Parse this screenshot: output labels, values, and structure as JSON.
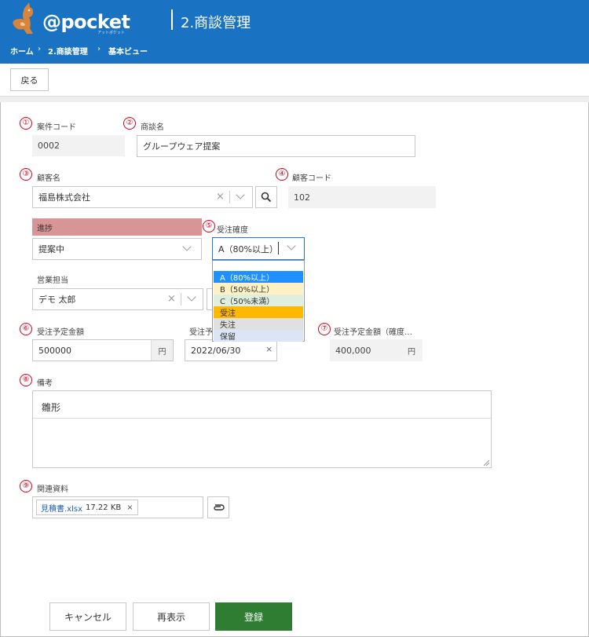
{
  "header": {
    "logo_text": "@pocket",
    "logo_sub": "アットポケット",
    "title": "2.商談管理",
    "breadcrumb": [
      "ホーム",
      "2.商談管理",
      "基本ビュー"
    ],
    "breadcrumb_sep": "›",
    "bg_color": "#1a73c2"
  },
  "toolbar": {
    "back_label": "戻る"
  },
  "markers": [
    "①",
    "②",
    "③",
    "④",
    "⑤",
    "⑥",
    "⑦",
    "⑧",
    "⑨"
  ],
  "form": {
    "case_code": {
      "label": "案件コード",
      "value": "0002"
    },
    "deal_name": {
      "label": "商談名",
      "value": "グループウェア提案"
    },
    "customer_name": {
      "label": "顧客名",
      "value": "福島株式会社",
      "clear_icon": "close-icon",
      "search_icon": "search-icon"
    },
    "customer_code": {
      "label": "顧客コード",
      "value": "102"
    },
    "progress": {
      "label": "進捗",
      "value": "提案中",
      "label_bg": "#d99595"
    },
    "probability": {
      "label": "受注確度",
      "value": "A（80%以上）",
      "options": [
        {
          "label": "",
          "bg": "#ffffff"
        },
        {
          "label": "A（80%以上）",
          "bg": "#1e90ff"
        },
        {
          "label": "B（50%以上）",
          "bg": "#fff1c4"
        },
        {
          "label": "C（50%未満）",
          "bg": "#dfeedd"
        },
        {
          "label": "受注",
          "bg": "#ffb800"
        },
        {
          "label": "失注",
          "bg": "#e0e0e0"
        },
        {
          "label": "保留",
          "bg": "#dbe5f5"
        }
      ]
    },
    "sales_rep": {
      "label": "営業担当",
      "value": "デモ 太郎"
    },
    "planned_amount": {
      "label": "受注予定金額",
      "value": "500000",
      "suffix": "円"
    },
    "planned_date": {
      "label": "受注予",
      "value": "2022/06/30",
      "clear": "×"
    },
    "weighted_amount": {
      "label": "受注予定金額（確度…",
      "value": "400,000",
      "suffix": "円"
    },
    "notes": {
      "label": "備考",
      "value": "雛形"
    },
    "attachments": {
      "label": "関連資料",
      "file_name": "見積書.xlsx",
      "file_size": "17.22 KB",
      "remove": "×"
    }
  },
  "footer": {
    "cancel_label": "キャンセル",
    "redisplay_label": "再表示",
    "save_label": "登録",
    "save_color": "#2e7d32"
  }
}
